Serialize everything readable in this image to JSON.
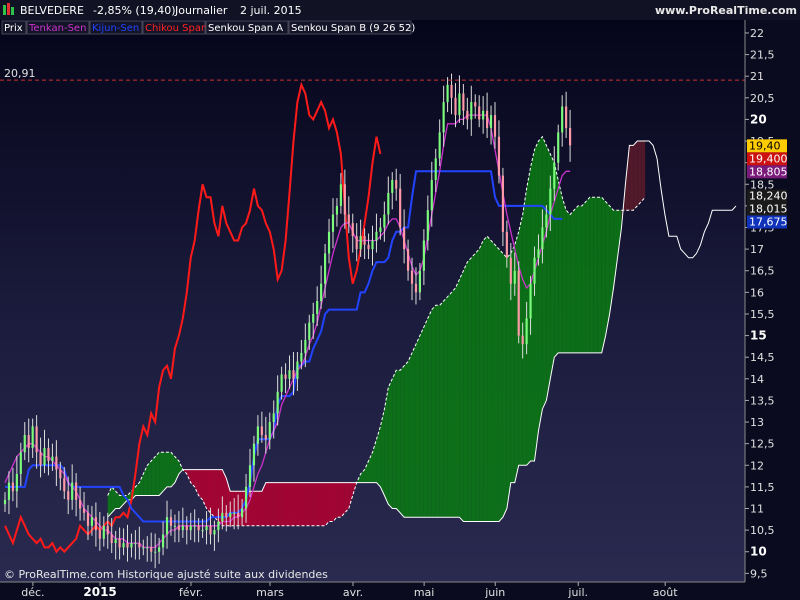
{
  "header": {
    "symbol": "BELVEDERE",
    "change": "-2,85% (19,40)",
    "period": "Journalier",
    "date": "2 juil. 2015",
    "site": "www.ProRealTime.com"
  },
  "legend": [
    {
      "label": "Prix",
      "color": "#ffffff"
    },
    {
      "label": "Tenkan-Sen",
      "color": "#cc33cc"
    },
    {
      "label": "Kijun-Sen",
      "color": "#2244ff"
    },
    {
      "label": "Chikou Span",
      "color": "#ff2222"
    },
    {
      "label": "Senkou Span A",
      "color": "#ffffff"
    },
    {
      "label": "Senkou Span B (9 26 52)",
      "color": "#ffffff"
    }
  ],
  "footer": "© ProRealTime.com  Historique ajusté suite aux dividendes",
  "colors": {
    "background": "#0b0b1f",
    "bull_candle": "#7CFC7C",
    "bear_candle": "#ff9aa8",
    "cloud_bull": "#0a7a12",
    "cloud_bear": "#b40030",
    "cloud_future_bear": "#5a1a2a",
    "tenkan": "#cc33cc",
    "kijun": "#2244ff",
    "chikou": "#ff1a1a",
    "ref_line": "#cc3333"
  },
  "chart_data": {
    "type": "candlestick",
    "title": "BELVEDERE",
    "grid": false,
    "y_axis_side": "right",
    "ylim": [
      9.3,
      22.3
    ],
    "y_ticks": [
      "22",
      "21,5",
      "21",
      "20,5",
      "20",
      "19,5",
      "19",
      "18,5",
      "18",
      "17,5",
      "17",
      "16,5",
      "16",
      "15,5",
      "15",
      "14,5",
      "14",
      "13,5",
      "13",
      "12,5",
      "12",
      "11,5",
      "11",
      "10,5",
      "10",
      "9,5"
    ],
    "y_ticks_bold": [
      "20",
      "15",
      "10"
    ],
    "x_ticks": [
      {
        "label": "déc.",
        "x": 2
      },
      {
        "label": "2015",
        "x": 19
      },
      {
        "label": "févr.",
        "x": 42
      },
      {
        "label": "mars",
        "x": 62
      },
      {
        "label": "avr.",
        "x": 83
      },
      {
        "label": "mai",
        "x": 101
      },
      {
        "label": "juin",
        "x": 119
      },
      {
        "label": "juil.",
        "x": 140
      },
      {
        "label": "août",
        "x": 162
      }
    ],
    "x_ticks_bold": [
      "2015"
    ],
    "x_range": [
      0,
      186
    ],
    "reference_line": {
      "value": 20.91,
      "label": "20,91"
    },
    "price_labels": [
      {
        "value": 19.4,
        "text": "19,40",
        "bg": "#ffcc00",
        "fg": "#000000"
      },
      {
        "value": 19.4,
        "text": "19,400",
        "bg": "#cc1111",
        "fg": "#ffffff",
        "offset": 1
      },
      {
        "value": 18.805,
        "text": "18,805",
        "bg": "#7a1a7a",
        "fg": "#ffffff"
      },
      {
        "value": 18.24,
        "text": "18,240",
        "bg": "#1a1a1a",
        "fg": "#ffffff"
      },
      {
        "value": 18.015,
        "text": "18,015",
        "bg": "#1a1a1a",
        "fg": "#ffffff"
      },
      {
        "value": 17.675,
        "text": "17,675",
        "bg": "#1133bb",
        "fg": "#ffffff",
        "offset": 1
      }
    ],
    "price_close": [
      11.2,
      11.6,
      11.4,
      11.8,
      12.3,
      12.7,
      12.4,
      12.9,
      12.3,
      12.0,
      12.4,
      12.1,
      12.2,
      11.9,
      11.7,
      11.4,
      11.2,
      11.6,
      11.2,
      11.0,
      10.9,
      10.6,
      10.8,
      10.5,
      10.3,
      10.6,
      10.4,
      10.2,
      10.3,
      10.1,
      10.2,
      10.1,
      10.2,
      10.2,
      10.1,
      10.1,
      10.1,
      10.0,
      10.0,
      10.1,
      10.4,
      10.8,
      10.6,
      10.6,
      10.5,
      10.6,
      10.5,
      10.6,
      10.6,
      10.5,
      10.5,
      10.6,
      10.4,
      10.5,
      10.7,
      10.9,
      10.8,
      10.9,
      10.9,
      10.8,
      11.0,
      11.5,
      12.0,
      12.5,
      12.9,
      12.7,
      12.6,
      13.0,
      13.2,
      13.7,
      14.1,
      14.0,
      14.2,
      14.0,
      14.4,
      14.6,
      14.9,
      15.3,
      15.5,
      15.8,
      16.2,
      16.9,
      17.4,
      17.8,
      18.0,
      18.5,
      17.8,
      17.6,
      17.3,
      17.0,
      17.3,
      17.1,
      17.0,
      17.2,
      17.4,
      17.5,
      17.8,
      18.3,
      18.6,
      18.4,
      17.5,
      17.0,
      16.5,
      16.2,
      16.0,
      16.5,
      17.2,
      17.9,
      18.6,
      19.1,
      19.7,
      20.4,
      20.8,
      20.5,
      20.1,
      20.6,
      20.2,
      20.0,
      20.4,
      20.3,
      20.0,
      20.2,
      19.8,
      20.1,
      19.6,
      18.7,
      17.4,
      16.8,
      16.2,
      16.5,
      15.0,
      14.8,
      15.4,
      16.2,
      16.8,
      17.0,
      17.5,
      17.8,
      18.4,
      19.0,
      19.7,
      20.3,
      19.8,
      19.4
    ],
    "tenkan": [
      11.6,
      11.8,
      12.0,
      12.2,
      12.3,
      12.4,
      12.5,
      12.5,
      12.4,
      12.3,
      12.2,
      12.2,
      12.1,
      12.0,
      11.9,
      11.8,
      11.6,
      11.5,
      11.4,
      11.2,
      11.0,
      10.9,
      10.8,
      10.7,
      10.6,
      10.5,
      10.5,
      10.4,
      10.3,
      10.3,
      10.3,
      10.2,
      10.2,
      10.2,
      10.2,
      10.1,
      10.1,
      10.1,
      10.1,
      10.2,
      10.3,
      10.4,
      10.5,
      10.5,
      10.6,
      10.6,
      10.6,
      10.6,
      10.6,
      10.6,
      10.6,
      10.6,
      10.6,
      10.6,
      10.6,
      10.7,
      10.7,
      10.7,
      10.8,
      10.8,
      10.9,
      11.0,
      11.2,
      11.5,
      11.8,
      12.0,
      12.3,
      12.6,
      12.8,
      13.0,
      13.4,
      13.6,
      13.8,
      14.0,
      14.2,
      14.3,
      14.5,
      14.8,
      15.0,
      15.3,
      15.7,
      16.1,
      16.5,
      16.9,
      17.2,
      17.5,
      17.6,
      17.6,
      17.4,
      17.2,
      17.2,
      17.2,
      17.2,
      17.2,
      17.2,
      17.3,
      17.4,
      17.6,
      17.7,
      17.7,
      17.5,
      17.2,
      16.9,
      16.6,
      16.4,
      16.5,
      16.8,
      17.3,
      17.8,
      18.3,
      18.8,
      19.4,
      19.9,
      19.9,
      19.9,
      20.0,
      20.0,
      20.1,
      20.1,
      20.1,
      20.1,
      20.1,
      20.1,
      19.8,
      19.3,
      18.8,
      18.3,
      17.8,
      17.4,
      17.0,
      16.6,
      16.3,
      16.1,
      16.2,
      16.5,
      16.8,
      17.1,
      17.4,
      17.8,
      18.1,
      18.4,
      18.7,
      18.8,
      18.8
    ],
    "kijun": [
      11.5,
      11.5,
      11.5,
      11.5,
      11.5,
      11.5,
      11.9,
      12.0,
      12.0,
      12.0,
      12.0,
      12.0,
      12.0,
      12.0,
      12.0,
      11.9,
      11.6,
      11.5,
      11.5,
      11.5,
      11.5,
      11.5,
      11.5,
      11.5,
      11.5,
      11.5,
      11.5,
      11.5,
      11.5,
      11.5,
      11.3,
      11.2,
      11.0,
      10.9,
      10.8,
      10.7,
      10.7,
      10.7,
      10.7,
      10.7,
      10.7,
      10.7,
      10.7,
      10.7,
      10.7,
      10.7,
      10.7,
      10.7,
      10.7,
      10.7,
      10.7,
      10.7,
      10.8,
      10.8,
      10.8,
      10.8,
      10.8,
      10.9,
      10.9,
      10.9,
      11.0,
      11.2,
      11.6,
      12.2,
      12.6,
      12.6,
      12.6,
      12.6,
      12.8,
      13.4,
      13.6,
      13.6,
      13.6,
      13.7,
      14.3,
      14.3,
      14.4,
      14.4,
      14.7,
      14.9,
      15.1,
      15.5,
      15.6,
      15.6,
      15.6,
      15.6,
      15.6,
      15.6,
      15.6,
      15.6,
      16.0,
      16.0,
      16.2,
      16.5,
      16.7,
      16.7,
      16.7,
      16.8,
      17.2,
      17.4,
      17.4,
      17.5,
      17.5,
      18.2,
      18.8,
      18.8,
      18.8,
      18.8,
      18.8,
      18.8,
      18.8,
      18.8,
      18.8,
      18.8,
      18.8,
      18.8,
      18.8,
      18.8,
      18.8,
      18.8,
      18.8,
      18.8,
      18.8,
      18.8,
      18.2,
      18.0,
      18.0,
      18.0,
      18.0,
      18.0,
      18.0,
      18.0,
      18.0,
      18.0,
      18.0,
      18.0,
      18.0,
      17.9,
      17.8,
      17.7,
      17.7,
      17.7
    ],
    "chikou": [
      10.6,
      10.4,
      10.2,
      10.5,
      10.8,
      10.6,
      10.4,
      10.3,
      10.2,
      10.3,
      10.1,
      10.1,
      10.2,
      10.0,
      10.1,
      10.0,
      10.1,
      10.2,
      10.3,
      10.6,
      10.5,
      10.4,
      10.5,
      10.6,
      10.5,
      10.6,
      10.7,
      10.6,
      10.8,
      10.8,
      10.9,
      10.8,
      11.2,
      11.8,
      12.5,
      12.9,
      12.7,
      13.2,
      13.0,
      13.8,
      14.2,
      14.3,
      14.0,
      14.7,
      15.0,
      15.4,
      16.0,
      16.8,
      17.2,
      17.9,
      18.5,
      18.2,
      18.2,
      17.6,
      17.3,
      18.0,
      17.6,
      17.4,
      17.2,
      17.2,
      17.5,
      17.6,
      17.9,
      18.4,
      18.0,
      17.9,
      17.6,
      17.4,
      17.0,
      16.3,
      16.5,
      17.2,
      18.3,
      19.5,
      20.4,
      20.8,
      20.6,
      20.1,
      20.0,
      20.2,
      20.4,
      20.2,
      19.8,
      20.0,
      19.7,
      19.2,
      18.0,
      16.8,
      16.2,
      16.5,
      17.0,
      17.6,
      18.2,
      19.0,
      19.6,
      19.2
    ],
    "senkou_a": [
      11.3,
      11.5,
      11.4,
      11.3,
      11.3,
      11.3,
      11.4,
      11.5,
      11.6,
      11.8,
      12.0,
      12.1,
      12.2,
      12.3,
      12.3,
      12.3,
      12.3,
      12.2,
      12.1,
      11.9,
      11.8,
      11.6,
      11.5,
      11.3,
      11.2,
      11.0,
      10.9,
      10.8,
      10.7,
      10.6,
      10.6,
      10.6,
      10.6,
      10.6,
      10.6,
      10.6,
      10.6,
      10.6,
      10.6,
      10.6,
      10.6,
      10.6,
      10.6,
      10.6,
      10.6,
      10.6,
      10.6,
      10.6,
      10.6,
      10.6,
      10.6,
      10.6,
      10.6,
      10.6,
      10.6,
      10.6,
      10.7,
      10.7,
      10.8,
      10.8,
      10.9,
      11.0,
      11.3,
      11.6,
      11.8,
      11.9,
      12.1,
      12.3,
      12.6,
      12.9,
      13.3,
      13.8,
      14.0,
      14.2,
      14.2,
      14.3,
      14.4,
      14.6,
      14.8,
      15.0,
      15.2,
      15.4,
      15.6,
      15.7,
      15.7,
      15.8,
      15.9,
      16.0,
      16.1,
      16.3,
      16.5,
      16.7,
      16.8,
      16.9,
      17.0,
      17.2,
      17.3,
      17.2,
      17.1,
      17.0,
      16.9,
      16.8,
      16.9,
      17.1,
      17.4,
      17.8,
      18.4,
      18.9,
      19.3,
      19.5,
      19.6,
      19.4,
      19.2,
      19.0,
      18.6,
      18.2,
      17.9,
      17.8,
      17.9,
      18.0,
      18.0,
      18.1,
      18.2,
      18.2,
      18.2,
      18.2,
      18.1,
      18.0,
      17.9,
      17.9,
      17.9,
      17.9,
      17.9,
      17.9,
      18.0,
      18.1,
      18.2
    ],
    "senkou_b": [
      10.8,
      10.9,
      11.0,
      11.0,
      11.1,
      11.2,
      11.2,
      11.3,
      11.3,
      11.3,
      11.3,
      11.3,
      11.3,
      11.3,
      11.4,
      11.5,
      11.5,
      11.6,
      11.8,
      11.9,
      11.9,
      11.9,
      11.9,
      11.9,
      11.9,
      11.9,
      11.9,
      11.9,
      11.9,
      11.9,
      11.7,
      11.4,
      11.4,
      11.4,
      11.4,
      11.4,
      11.4,
      11.4,
      11.4,
      11.4,
      11.6,
      11.6,
      11.6,
      11.6,
      11.6,
      11.6,
      11.6,
      11.6,
      11.6,
      11.6,
      11.6,
      11.6,
      11.6,
      11.6,
      11.6,
      11.6,
      11.6,
      11.6,
      11.6,
      11.6,
      11.6,
      11.6,
      11.6,
      11.6,
      11.6,
      11.6,
      11.6,
      11.6,
      11.6,
      11.5,
      11.3,
      11.1,
      11.0,
      11.0,
      10.9,
      10.8,
      10.8,
      10.8,
      10.8,
      10.8,
      10.8,
      10.8,
      10.8,
      10.8,
      10.8,
      10.8,
      10.8,
      10.8,
      10.8,
      10.8,
      10.7,
      10.7,
      10.7,
      10.7,
      10.7,
      10.7,
      10.7,
      10.7,
      10.7,
      10.7,
      10.8,
      11.0,
      11.6,
      11.6,
      12.0,
      12.0,
      12.0,
      12.1,
      12.1,
      12.8,
      13.3,
      13.5,
      14.0,
      14.5,
      14.6,
      14.6,
      14.6,
      14.6,
      14.6,
      14.6,
      14.6,
      14.6,
      14.6,
      14.6,
      14.6,
      14.6,
      15.0,
      15.5,
      16.1,
      16.8,
      17.5,
      18.5,
      19.4,
      19.4,
      19.5,
      19.5,
      19.5,
      19.5,
      19.4,
      19.1,
      18.4,
      17.8,
      17.3,
      17.3,
      17.3,
      17.0,
      16.9,
      16.8,
      16.8,
      16.9,
      17.1,
      17.4,
      17.6,
      17.9,
      17.9,
      17.9,
      17.9,
      17.9,
      17.9,
      18.0
    ]
  }
}
